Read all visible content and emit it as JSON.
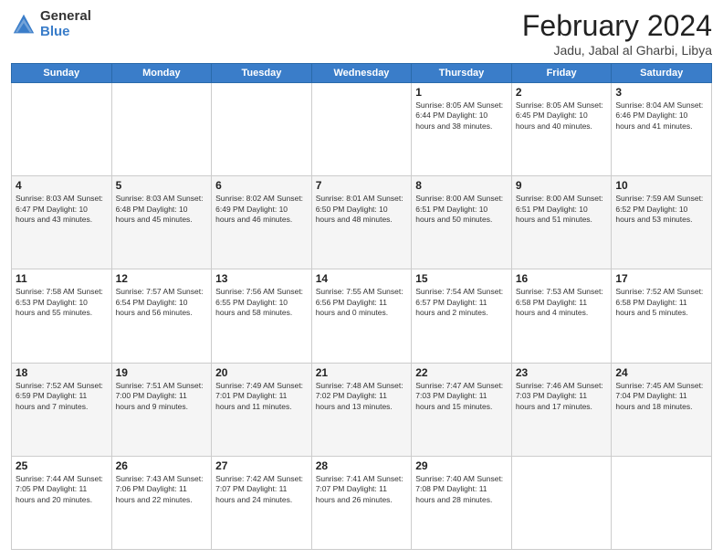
{
  "logo": {
    "general": "General",
    "blue": "Blue"
  },
  "title": "February 2024",
  "location": "Jadu, Jabal al Gharbi, Libya",
  "headers": [
    "Sunday",
    "Monday",
    "Tuesday",
    "Wednesday",
    "Thursday",
    "Friday",
    "Saturday"
  ],
  "weeks": [
    [
      {
        "day": "",
        "info": ""
      },
      {
        "day": "",
        "info": ""
      },
      {
        "day": "",
        "info": ""
      },
      {
        "day": "",
        "info": ""
      },
      {
        "day": "1",
        "info": "Sunrise: 8:05 AM\nSunset: 6:44 PM\nDaylight: 10 hours\nand 38 minutes."
      },
      {
        "day": "2",
        "info": "Sunrise: 8:05 AM\nSunset: 6:45 PM\nDaylight: 10 hours\nand 40 minutes."
      },
      {
        "day": "3",
        "info": "Sunrise: 8:04 AM\nSunset: 6:46 PM\nDaylight: 10 hours\nand 41 minutes."
      }
    ],
    [
      {
        "day": "4",
        "info": "Sunrise: 8:03 AM\nSunset: 6:47 PM\nDaylight: 10 hours\nand 43 minutes."
      },
      {
        "day": "5",
        "info": "Sunrise: 8:03 AM\nSunset: 6:48 PM\nDaylight: 10 hours\nand 45 minutes."
      },
      {
        "day": "6",
        "info": "Sunrise: 8:02 AM\nSunset: 6:49 PM\nDaylight: 10 hours\nand 46 minutes."
      },
      {
        "day": "7",
        "info": "Sunrise: 8:01 AM\nSunset: 6:50 PM\nDaylight: 10 hours\nand 48 minutes."
      },
      {
        "day": "8",
        "info": "Sunrise: 8:00 AM\nSunset: 6:51 PM\nDaylight: 10 hours\nand 50 minutes."
      },
      {
        "day": "9",
        "info": "Sunrise: 8:00 AM\nSunset: 6:51 PM\nDaylight: 10 hours\nand 51 minutes."
      },
      {
        "day": "10",
        "info": "Sunrise: 7:59 AM\nSunset: 6:52 PM\nDaylight: 10 hours\nand 53 minutes."
      }
    ],
    [
      {
        "day": "11",
        "info": "Sunrise: 7:58 AM\nSunset: 6:53 PM\nDaylight: 10 hours\nand 55 minutes."
      },
      {
        "day": "12",
        "info": "Sunrise: 7:57 AM\nSunset: 6:54 PM\nDaylight: 10 hours\nand 56 minutes."
      },
      {
        "day": "13",
        "info": "Sunrise: 7:56 AM\nSunset: 6:55 PM\nDaylight: 10 hours\nand 58 minutes."
      },
      {
        "day": "14",
        "info": "Sunrise: 7:55 AM\nSunset: 6:56 PM\nDaylight: 11 hours\nand 0 minutes."
      },
      {
        "day": "15",
        "info": "Sunrise: 7:54 AM\nSunset: 6:57 PM\nDaylight: 11 hours\nand 2 minutes."
      },
      {
        "day": "16",
        "info": "Sunrise: 7:53 AM\nSunset: 6:58 PM\nDaylight: 11 hours\nand 4 minutes."
      },
      {
        "day": "17",
        "info": "Sunrise: 7:52 AM\nSunset: 6:58 PM\nDaylight: 11 hours\nand 5 minutes."
      }
    ],
    [
      {
        "day": "18",
        "info": "Sunrise: 7:52 AM\nSunset: 6:59 PM\nDaylight: 11 hours\nand 7 minutes."
      },
      {
        "day": "19",
        "info": "Sunrise: 7:51 AM\nSunset: 7:00 PM\nDaylight: 11 hours\nand 9 minutes."
      },
      {
        "day": "20",
        "info": "Sunrise: 7:49 AM\nSunset: 7:01 PM\nDaylight: 11 hours\nand 11 minutes."
      },
      {
        "day": "21",
        "info": "Sunrise: 7:48 AM\nSunset: 7:02 PM\nDaylight: 11 hours\nand 13 minutes."
      },
      {
        "day": "22",
        "info": "Sunrise: 7:47 AM\nSunset: 7:03 PM\nDaylight: 11 hours\nand 15 minutes."
      },
      {
        "day": "23",
        "info": "Sunrise: 7:46 AM\nSunset: 7:03 PM\nDaylight: 11 hours\nand 17 minutes."
      },
      {
        "day": "24",
        "info": "Sunrise: 7:45 AM\nSunset: 7:04 PM\nDaylight: 11 hours\nand 18 minutes."
      }
    ],
    [
      {
        "day": "25",
        "info": "Sunrise: 7:44 AM\nSunset: 7:05 PM\nDaylight: 11 hours\nand 20 minutes."
      },
      {
        "day": "26",
        "info": "Sunrise: 7:43 AM\nSunset: 7:06 PM\nDaylight: 11 hours\nand 22 minutes."
      },
      {
        "day": "27",
        "info": "Sunrise: 7:42 AM\nSunset: 7:07 PM\nDaylight: 11 hours\nand 24 minutes."
      },
      {
        "day": "28",
        "info": "Sunrise: 7:41 AM\nSunset: 7:07 PM\nDaylight: 11 hours\nand 26 minutes."
      },
      {
        "day": "29",
        "info": "Sunrise: 7:40 AM\nSunset: 7:08 PM\nDaylight: 11 hours\nand 28 minutes."
      },
      {
        "day": "",
        "info": ""
      },
      {
        "day": "",
        "info": ""
      }
    ]
  ]
}
